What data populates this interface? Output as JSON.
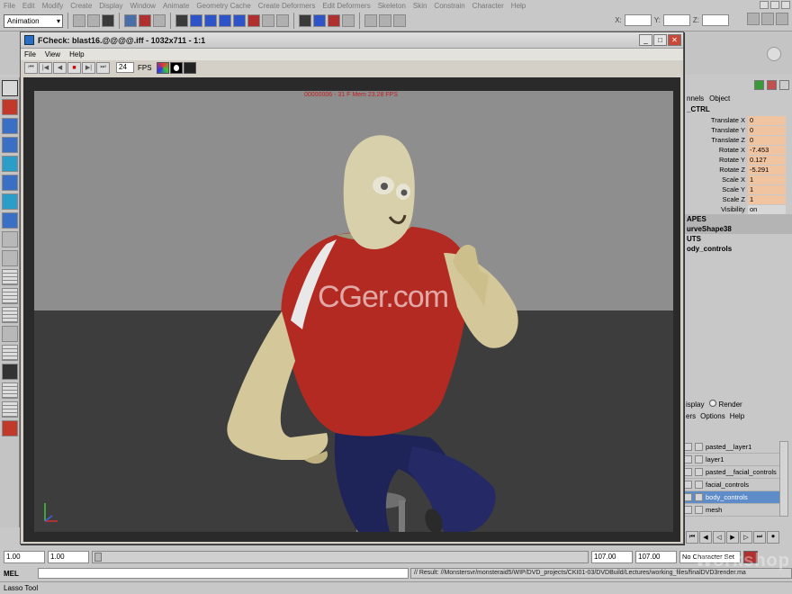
{
  "maya": {
    "menu": [
      "File",
      "Edit",
      "Modify",
      "Create",
      "Display",
      "Window",
      "Animate",
      "Geometry Cache",
      "Create Deformers",
      "Edit Deformers",
      "Skeleton",
      "Skin",
      "Constrain",
      "Character",
      "Help"
    ],
    "mode": "Animation",
    "xyz": {
      "x": "X:",
      "y": "Y:",
      "z": "Z:"
    }
  },
  "fcheck": {
    "title": "FCheck: blast16.@@@@.iff - 1032x711 - 1:1",
    "menu": {
      "file": "File",
      "view": "View",
      "help": "Help"
    },
    "fps_value": "24",
    "fps_label": "FPS",
    "hud_top": "00000006 - 31 F Mem 23.28 FPS",
    "watermark": "CGer.com"
  },
  "channel_box": {
    "menu": {
      "channels": "nnels",
      "object": "Object"
    },
    "node": "_CTRL",
    "attributes": [
      {
        "name": "Translate X",
        "value": "0"
      },
      {
        "name": "Translate Y",
        "value": "0"
      },
      {
        "name": "Translate Z",
        "value": "0"
      },
      {
        "name": "Rotate X",
        "value": "-7.453"
      },
      {
        "name": "Rotate Y",
        "value": "0.127"
      },
      {
        "name": "Rotate Z",
        "value": "-5.291"
      },
      {
        "name": "Scale X",
        "value": "1"
      },
      {
        "name": "Scale Y",
        "value": "1"
      },
      {
        "name": "Scale Z",
        "value": "1"
      },
      {
        "name": "Visibility",
        "value": "on"
      }
    ],
    "shapes_header": "APES",
    "shape_name": "urveShape38",
    "inputs_header": "UTS",
    "input_name": "ody_controls"
  },
  "layers": {
    "tabs": {
      "display": "isplay",
      "render": "Render"
    },
    "menu": {
      "layers": "ers",
      "options": "Options",
      "help": "Help"
    },
    "items": [
      "pasted__layer1",
      "layer1",
      "pasted__facial_controls",
      "facial_controls",
      "body_controls",
      "mesh"
    ],
    "selected_index": 4
  },
  "time": {
    "start": "1.00",
    "range_start": "1.00",
    "range_end": "107.00",
    "end": "107.00",
    "char_set": "No Character Set"
  },
  "command": {
    "mel_label": "MEL",
    "result": "// Result: //Monstersvr/monsteraid5/WIP/DVD_projects/CKI01-03/DVDBuild/Lectures/working_files/finalDVD3render.ma"
  },
  "help_line": "Lasso Tool",
  "brand_watermark": "Workshop"
}
